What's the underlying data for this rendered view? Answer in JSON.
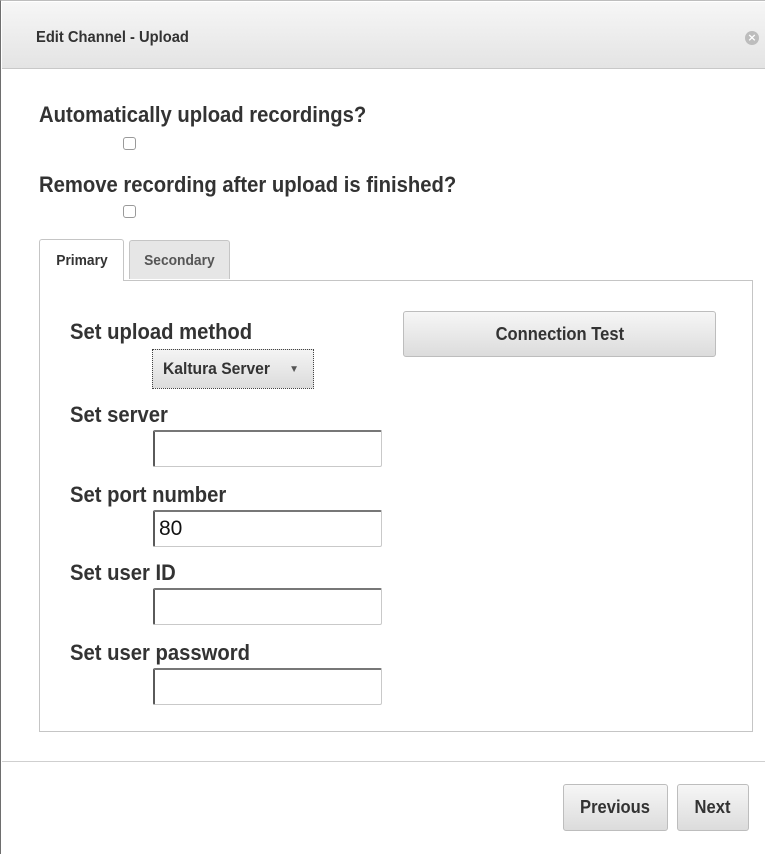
{
  "dialog": {
    "title": "Edit Channel - Upload",
    "close_icon": "close-icon"
  },
  "options": {
    "auto_upload_label": "Automatically upload recordings?",
    "auto_upload_checked": false,
    "remove_after_upload_label": "Remove recording after upload is finished?",
    "remove_after_upload_checked": false
  },
  "tabs": [
    {
      "label": "Primary",
      "active": true
    },
    {
      "label": "Secondary",
      "active": false
    }
  ],
  "form": {
    "upload_method_label": "Set upload method",
    "upload_method_value": "Kaltura Server",
    "connection_test_label": "Connection Test",
    "server_label": "Set server",
    "server_value": "",
    "port_label": "Set port number",
    "port_value": "80",
    "user_id_label": "Set user ID",
    "user_id_value": "",
    "password_label": "Set user password",
    "password_value": ""
  },
  "footer": {
    "previous_label": "Previous",
    "next_label": "Next"
  }
}
